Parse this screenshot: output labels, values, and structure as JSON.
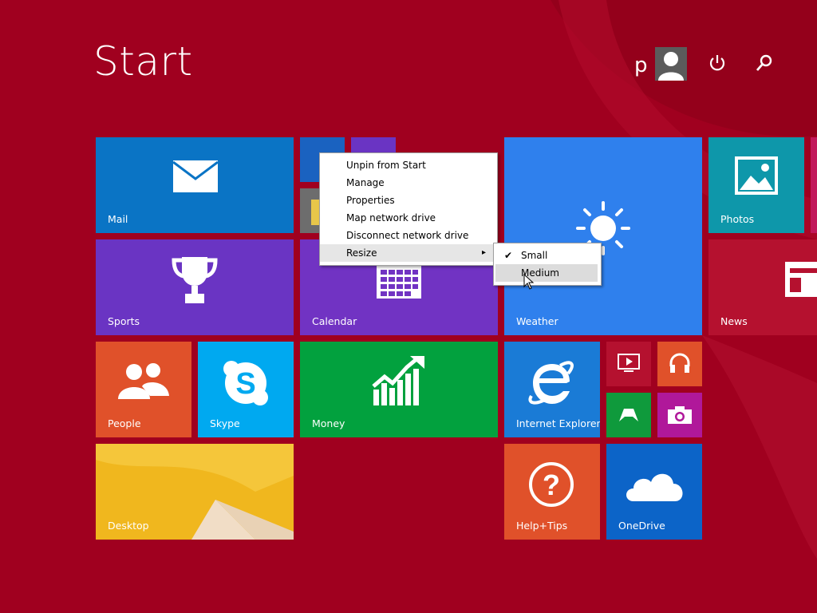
{
  "screen": {
    "title": "Start"
  },
  "user": {
    "name": "p"
  },
  "tiles": {
    "mail": "Mail",
    "sports": "Sports",
    "calendar": "Calendar",
    "weather": "Weather",
    "photos": "Photos",
    "news": "News",
    "people": "People",
    "skype": "Skype",
    "money": "Money",
    "internet_explorer": "Internet Explorer",
    "desktop": "Desktop",
    "help_tips": "Help+Tips",
    "onedrive": "OneDrive"
  },
  "context_menu": {
    "items": [
      "Unpin from Start",
      "Manage",
      "Properties",
      "Map network drive",
      "Disconnect network drive",
      "Resize"
    ],
    "highlighted": "Resize"
  },
  "resize_submenu": {
    "items": [
      "Small",
      "Medium"
    ],
    "checked": "Small",
    "highlighted": "Medium"
  },
  "colors": {
    "background": "#a0001f",
    "mail": "#0a74c5",
    "sports": "#6a34c3",
    "calendar": "#7133c3",
    "weather": "#2f80ed",
    "photos": "#0e97aa",
    "people": "#e0512a",
    "skype": "#00a9f0",
    "money": "#02a13e",
    "internet_explorer": "#1a7bd6",
    "help_tips": "#e0512a",
    "onedrive": "#0c64c8"
  },
  "icons": [
    "user-avatar-icon",
    "power-icon",
    "search-icon",
    "mail-icon",
    "trophy-icon",
    "calendar-icon",
    "sun-icon",
    "photos-icon",
    "news-icon",
    "people-icon",
    "skype-icon",
    "money-chart-icon",
    "internet-explorer-icon",
    "question-icon",
    "cloud-icon",
    "video-icon",
    "headphones-icon",
    "xbox-icon",
    "camera-icon",
    "checkmark-icon",
    "chevron-right-icon",
    "mouse-cursor-icon"
  ]
}
